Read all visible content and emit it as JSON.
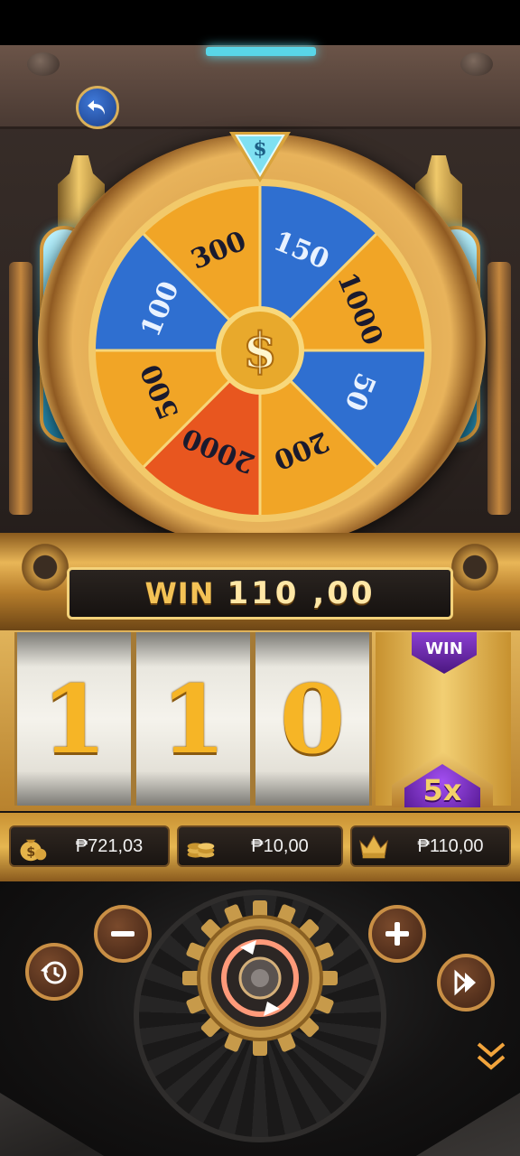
{
  "colors": {
    "gold": "#f3c256",
    "wheel_blue": "#2f6fd0",
    "wheel_orange": "#f1a526",
    "wheel_red": "#e8561f",
    "accent_cyan": "#59d6e8"
  },
  "icons": {
    "back": "undo-arrow-icon",
    "top_marker": "dollar-diamond-icon",
    "wheel_center": "dollar-coin-icon",
    "balance": "money-bag-icon",
    "bet": "coin-stack-icon",
    "win": "crown-win-icon",
    "minus": "minus-icon",
    "plus": "plus-icon",
    "history": "history-clock-icon",
    "turbo": "fast-forward-icon",
    "spin": "spin-refresh-icon",
    "more": "chevron-double-down-icon"
  },
  "wheel": {
    "center_symbol": "$",
    "top_symbol": "$",
    "segments": [
      {
        "label": "150",
        "color": "blue"
      },
      {
        "label": "1000",
        "color": "orange"
      },
      {
        "label": "50",
        "color": "blue"
      },
      {
        "label": "200",
        "color": "orange"
      },
      {
        "label": "2000",
        "color": "red"
      },
      {
        "label": "500",
        "color": "orange"
      },
      {
        "label": "100",
        "color": "blue"
      },
      {
        "label": "300",
        "color": "orange"
      }
    ]
  },
  "win_banner": {
    "label": "WIN",
    "amount": "110 ,00"
  },
  "reels": {
    "digits": [
      "1",
      "1",
      "0"
    ],
    "bonus_top_badge": "WIN",
    "bonus_multiplier": "5x"
  },
  "stats": {
    "balance": "₱721,03",
    "bet": "₱10,00",
    "win": "₱110,00"
  }
}
